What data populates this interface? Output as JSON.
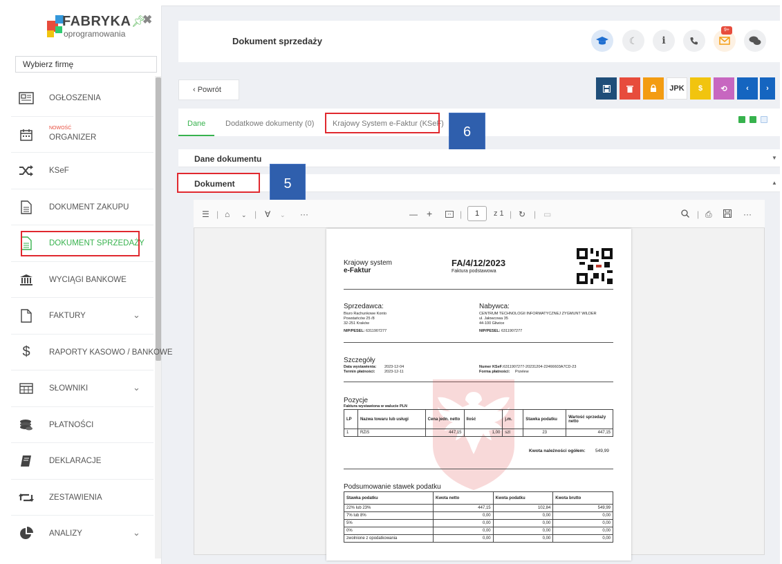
{
  "sidebar": {
    "logo_name": "FABRYKA",
    "logo_sub": "oprogramowania",
    "firm_select": "Wybierz firmę",
    "items": [
      {
        "label": "OGŁOSZENIA",
        "icon": "newspaper-icon"
      },
      {
        "label": "ORGANIZER",
        "tag": "NOWOŚĆ",
        "icon": "calendar-icon"
      },
      {
        "label": "KSeF",
        "icon": "shuffle-icon"
      },
      {
        "label": "DOKUMENT ZAKUPU",
        "icon": "file-text-icon"
      },
      {
        "label": "DOKUMENT SPRZEDAŻY",
        "icon": "file-text-icon"
      },
      {
        "label": "WYCIĄGI BANKOWE",
        "icon": "bank-icon"
      },
      {
        "label": "FAKTURY",
        "icon": "file-icon",
        "chevron": "⌄"
      },
      {
        "label": "RAPORTY KASOWO / BANKOWE",
        "icon": "dollar-icon"
      },
      {
        "label": "SŁOWNIKI",
        "icon": "table-icon",
        "chevron": "⌄"
      },
      {
        "label": "PŁATNOŚCI",
        "icon": "coins-icon"
      },
      {
        "label": "DEKLARACJE",
        "icon": "book-icon"
      },
      {
        "label": "ZESTAWIENIA",
        "icon": "retweet-icon"
      },
      {
        "label": "ANALIZY",
        "icon": "pie-chart-icon",
        "chevron": "⌄"
      }
    ]
  },
  "header": {
    "title": "Dokument sprzedaży",
    "badge": "9+"
  },
  "toolbar": {
    "back_label": "‹  Powrót",
    "jpk_label": "JPK",
    "dollar_label": "$",
    "prev_label": "‹",
    "next_label": "›"
  },
  "tabs": [
    {
      "label": "Dane"
    },
    {
      "label": "Dodatkowe dokumenty (0)"
    },
    {
      "label": "Krajowy System e-Faktur (KSeF)"
    }
  ],
  "callouts": {
    "five": "5",
    "six": "6"
  },
  "sections": {
    "dane_dokumentu": "Dane dokumentu",
    "dokument": "Dokument"
  },
  "pdf_toolbar": {
    "page": "1",
    "page_of": "z 1",
    "more": "···",
    "minus": "—",
    "plus": "+"
  },
  "invoice": {
    "system_line1": "Krajowy system",
    "system_line2": "e-Faktur",
    "number": "FA/4/12/2023",
    "type": "Faktura podstawowa",
    "seller_h": "Sprzedawca:",
    "seller_name": "Biuro Rachunkowe Konto",
    "seller_addr1": "Powstańców 25 /8",
    "seller_addr2": "32-251 Kraków",
    "seller_nip_label": "NIP/PESEL:",
    "seller_nip": "6311907277",
    "buyer_h": "Nabywca:",
    "buyer_name": "CENTRUM TECHNOLOGII INFORMATYCZNEJ ZYGMUNT WILDER",
    "buyer_addr1": "ul. Jałowcowa 35",
    "buyer_addr2": "44-100 Gliwice",
    "buyer_nip_label": "NIP/PESEL:",
    "buyer_nip": "6311907277",
    "details_h": "Szczegóły",
    "issue_label": "Data wystawienia:",
    "issue_date": "2023-12-04",
    "due_label": "Termin płatności:",
    "due_date": "2023-12-11",
    "ksef_label": "Numer KSeF:",
    "ksef_number": "6311907277-20231204-22466603A7CD-23",
    "payment_label": "Forma płatności:",
    "payment": "Przelew",
    "positions_h": "Pozycje",
    "currency_note": "Faktura wystawiona w walucie PLN",
    "items_headers": [
      "LP",
      "Nazwa towaru lub usługi",
      "Cena jedn. netto",
      "Ilość",
      "j.m.",
      "Stawka podatku",
      "Wartość sprzedaży netto"
    ],
    "items_rows": [
      [
        "1",
        "RZiS",
        "447,15",
        "1,00",
        "szt",
        "23",
        "447,15"
      ]
    ],
    "total_label": "Kwota należności ogółem:",
    "total_value": "549,99",
    "summary_h": "Podsumowanie stawek podatku",
    "summary_headers": [
      "Stawka podatku",
      "Kwota netto",
      "Kwota podatku",
      "Kwota brutto"
    ],
    "summary_rows": [
      [
        "22% lub 23%",
        "447,15",
        "102,84",
        "549,99"
      ],
      [
        "7% lub 8%",
        "0,00",
        "0,00",
        "0,00"
      ],
      [
        "5%",
        "0,00",
        "0,00",
        "0,00"
      ],
      [
        "0%",
        "0,00",
        "0,00",
        "0,00"
      ],
      [
        "zwolnione z opodatkowania",
        "0,00",
        "0,00",
        "0,00"
      ]
    ]
  },
  "colors": {
    "accent_green": "#37b24d",
    "highlight_red": "#e0282e",
    "callout_blue": "#2f5fad",
    "btn_navy": "#1f4e79",
    "btn_red": "#e74c3c",
    "btn_orange": "#f39c12",
    "btn_yellow": "#f1c40f",
    "btn_pink": "#c767c0",
    "btn_blue": "#1565c0"
  }
}
